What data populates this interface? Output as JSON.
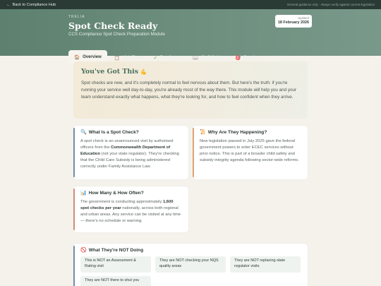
{
  "topbar": {
    "back_label": "Back to Compliance Hub",
    "note": "General guidance only · Always verify against current legislation"
  },
  "header": {
    "brand": "TRELIA",
    "title": "Spot Check Ready",
    "subtitle": "CCS Compliance Spot Check Preparation Module",
    "updated_label": "Updated",
    "updated_date": "18 February 2026"
  },
  "tabs": [
    {
      "label": "Overview",
      "icon": "house-icon",
      "active": true
    },
    {
      "label": "Visit Flow",
      "icon": "clipboard-icon",
      "active": false
    },
    {
      "label": "Readiness",
      "icon": "checkmark-icon",
      "active": false
    },
    {
      "label": "Staff Guide",
      "icon": "book-icon",
      "active": false
    },
    {
      "label": "Practice",
      "icon": "target-icon",
      "active": false
    }
  ],
  "hero": {
    "title": "You've Got This",
    "title_emoji": "flexed-biceps-icon",
    "text": "Spot checks are new, and it's completely normal to feel nervous about them. But here's the truth: if you're running your service well day-to-day, you're already most of the way there. This module will help you and your team understand exactly what happens, what they're looking for, and how to feel confident when they arrive."
  },
  "cards": {
    "what": {
      "title": "What Is a Spot Check?",
      "icon": "magnifier-icon",
      "text_1": "A spot check is an unannounced visit by authorised officers from the ",
      "bold": "Commonwealth Department of Education",
      "text_2": " (not your state regulator). They're checking that the Child Care Subsidy is being administered correctly under Family Assistance Law."
    },
    "why": {
      "title": "Why Are They Happening?",
      "icon": "scroll-icon",
      "text": "New legislation passed in July 2025 gave the federal government powers to enter ECEC services without prior notice. This is part of a broader child safety and subsidy integrity agenda following sector-wide reforms."
    },
    "many": {
      "title": "How Many & How Often?",
      "icon": "bar-chart-icon",
      "text_1": "The government is conducting approximately ",
      "bold": "1,600 spot checks per year",
      "text_2": " nationally, across both regional and urban areas. Any service can be visited at any time — there's no schedule or warning."
    },
    "not": {
      "title": "What They're NOT Doing",
      "icon": "prohibited-icon",
      "items": [
        "This is NOT an Assessment & Rating visit",
        "They are NOT checking your NQS quality areas",
        "They are NOT replacing state regulator visits",
        "They are NOT there to shut you"
      ]
    }
  },
  "colors": {
    "header": "#6c8d7c",
    "accent_blue": "#6f8fab",
    "accent_orange": "#e0a374",
    "accent_red": "#d48b7c"
  }
}
